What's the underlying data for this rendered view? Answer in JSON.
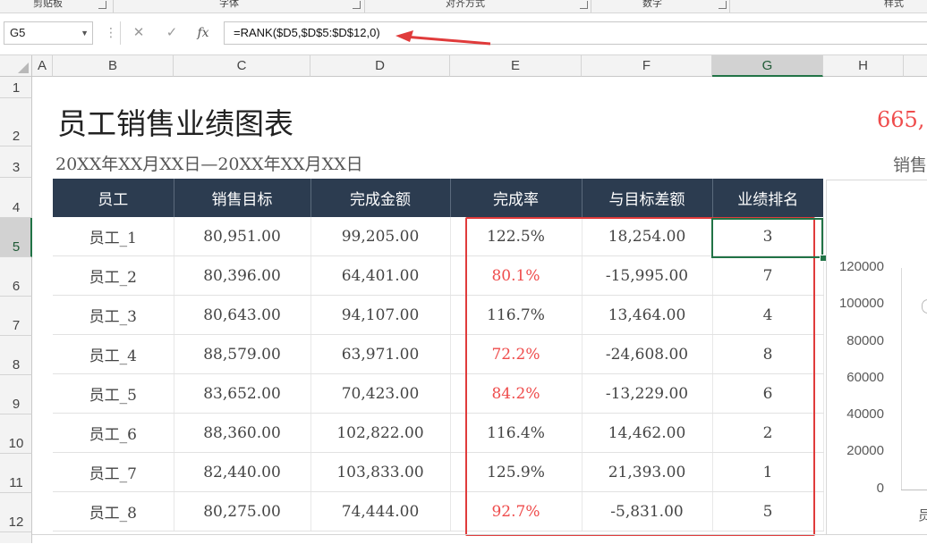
{
  "ribbon": {
    "groups": [
      "剪贴板",
      "字体",
      "对齐方式",
      "数字",
      "样式"
    ]
  },
  "formula_bar": {
    "name_box": "G5",
    "cancel_icon": "✕",
    "enter_icon": "✓",
    "fx_label": "fx",
    "formula": "=RANK($D5,$D$5:$D$12,0)"
  },
  "columns": [
    "A",
    "B",
    "C",
    "D",
    "E",
    "F",
    "G",
    "H"
  ],
  "selected_column": "G",
  "rows": [
    "1",
    "2",
    "3",
    "4",
    "5",
    "6",
    "7",
    "8",
    "9",
    "10",
    "11",
    "12"
  ],
  "selected_row": "5",
  "sheet": {
    "title": "员工销售业绩图表",
    "subtitle": "20XX年XX月XX日—20XX年XX月XX日",
    "total_value": "665,",
    "sales_label": "销售"
  },
  "table": {
    "headers": [
      "员工",
      "销售目标",
      "完成金额",
      "完成率",
      "与目标差额",
      "业绩排名"
    ],
    "rows": [
      {
        "name": "员工_1",
        "target": "80,951.00",
        "done": "99,205.00",
        "rate": "122.5%",
        "diff": "18,254.00",
        "rank": "3",
        "below": false
      },
      {
        "name": "员工_2",
        "target": "80,396.00",
        "done": "64,401.00",
        "rate": "80.1%",
        "diff": "-15,995.00",
        "rank": "7",
        "below": true
      },
      {
        "name": "员工_3",
        "target": "80,643.00",
        "done": "94,107.00",
        "rate": "116.7%",
        "diff": "13,464.00",
        "rank": "4",
        "below": false
      },
      {
        "name": "员工_4",
        "target": "88,579.00",
        "done": "63,971.00",
        "rate": "72.2%",
        "diff": "-24,608.00",
        "rank": "8",
        "below": true
      },
      {
        "name": "员工_5",
        "target": "83,652.00",
        "done": "70,423.00",
        "rate": "84.2%",
        "diff": "-13,229.00",
        "rank": "6",
        "below": true
      },
      {
        "name": "员工_6",
        "target": "88,360.00",
        "done": "102,822.00",
        "rate": "116.4%",
        "diff": "14,462.00",
        "rank": "2",
        "below": false
      },
      {
        "name": "员工_7",
        "target": "82,440.00",
        "done": "103,833.00",
        "rate": "125.9%",
        "diff": "21,393.00",
        "rank": "1",
        "below": false
      },
      {
        "name": "员工_8",
        "target": "80,275.00",
        "done": "74,444.00",
        "rate": "92.7%",
        "diff": "-5,831.00",
        "rank": "5",
        "below": true
      }
    ]
  },
  "chart": {
    "y_ticks": [
      "120000",
      "100000",
      "80000",
      "60000",
      "40000",
      "20000",
      "0"
    ],
    "x_label_partial": "员"
  },
  "colors": {
    "header_bg": "#2c3c50",
    "negative": "#ef4c4c",
    "selection": "#217346",
    "annotation": "#e03b3b"
  }
}
